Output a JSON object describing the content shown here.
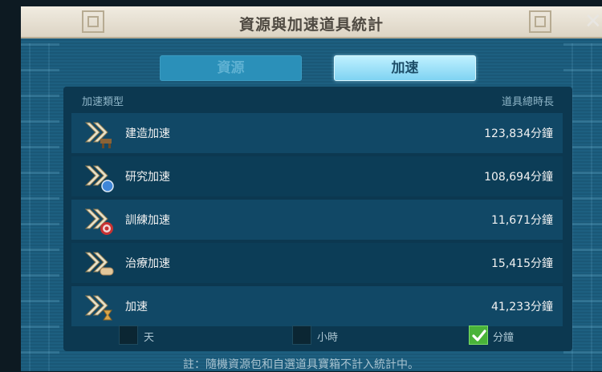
{
  "window": {
    "title": "資源與加速道具統計",
    "close_label": "✕"
  },
  "tabs": [
    {
      "label": "資源",
      "active": false
    },
    {
      "label": "加速",
      "active": true
    }
  ],
  "table": {
    "header_type": "加速類型",
    "header_total": "道具總時長",
    "rows": [
      {
        "name": "建造加速",
        "value": "123,834分鐘",
        "icon": "build-speedup-icon"
      },
      {
        "name": "研究加速",
        "value": "108,694分鐘",
        "icon": "research-speedup-icon"
      },
      {
        "name": "訓練加速",
        "value": "11,671分鐘",
        "icon": "training-speedup-icon"
      },
      {
        "name": "治療加速",
        "value": "15,415分鐘",
        "icon": "healing-speedup-icon"
      },
      {
        "name": "加速",
        "value": "41,233分鐘",
        "icon": "general-speedup-icon"
      }
    ]
  },
  "units": [
    {
      "label": "天",
      "checked": false
    },
    {
      "label": "小時",
      "checked": false
    },
    {
      "label": "分鐘",
      "checked": true
    }
  ],
  "note": "註：隨機資源包和自選道具寶箱不計入統計中。",
  "colors": {
    "accent": "#7fd3f2",
    "panel": "#0c3850",
    "check": "#49b339"
  }
}
